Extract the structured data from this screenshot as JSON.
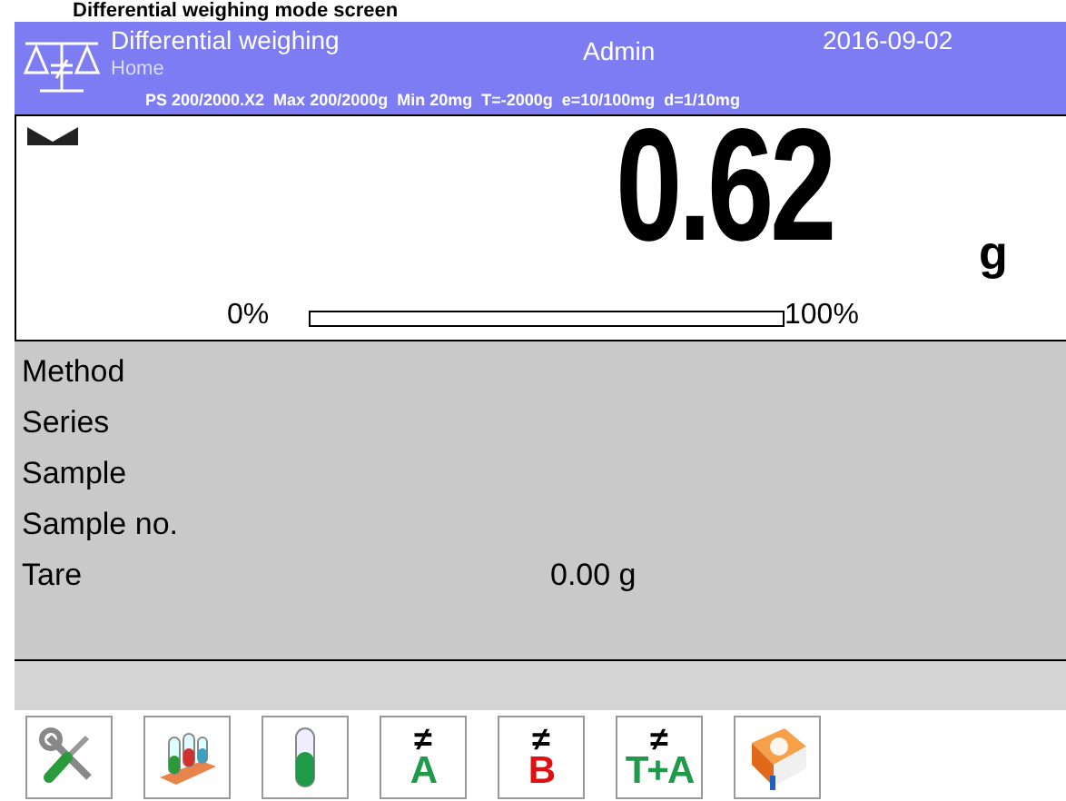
{
  "caption": "Differential weighing mode screen",
  "header": {
    "title": "Differential weighing",
    "subtitle": "Home",
    "user": "Admin",
    "date": "2016-09-02",
    "specs": "PS 200/2000.X2  Max 200/2000g  Min 20mg  T=-2000g  e=10/100mg  d=1/10mg"
  },
  "display": {
    "value": "0.62",
    "unit": "g",
    "bar_min": "0%",
    "bar_max": "100%",
    "level": 0
  },
  "info": [
    {
      "label": "Method"
    },
    {
      "label": "Series"
    },
    {
      "label": "Sample"
    },
    {
      "label": "Sample no."
    },
    {
      "label": "Tare",
      "value": "0.00 g"
    }
  ],
  "buttons": [
    {
      "kind": "tools"
    },
    {
      "kind": "series"
    },
    {
      "kind": "sample"
    },
    {
      "kind": "text",
      "sign": "≠",
      "label": "A",
      "color": "#1f9a4a"
    },
    {
      "kind": "text",
      "sign": "≠",
      "label": "B",
      "color": "#e01010"
    },
    {
      "kind": "text",
      "sign": "≠",
      "label": "T+A",
      "color": "#1f9a4a"
    },
    {
      "kind": "help"
    }
  ]
}
